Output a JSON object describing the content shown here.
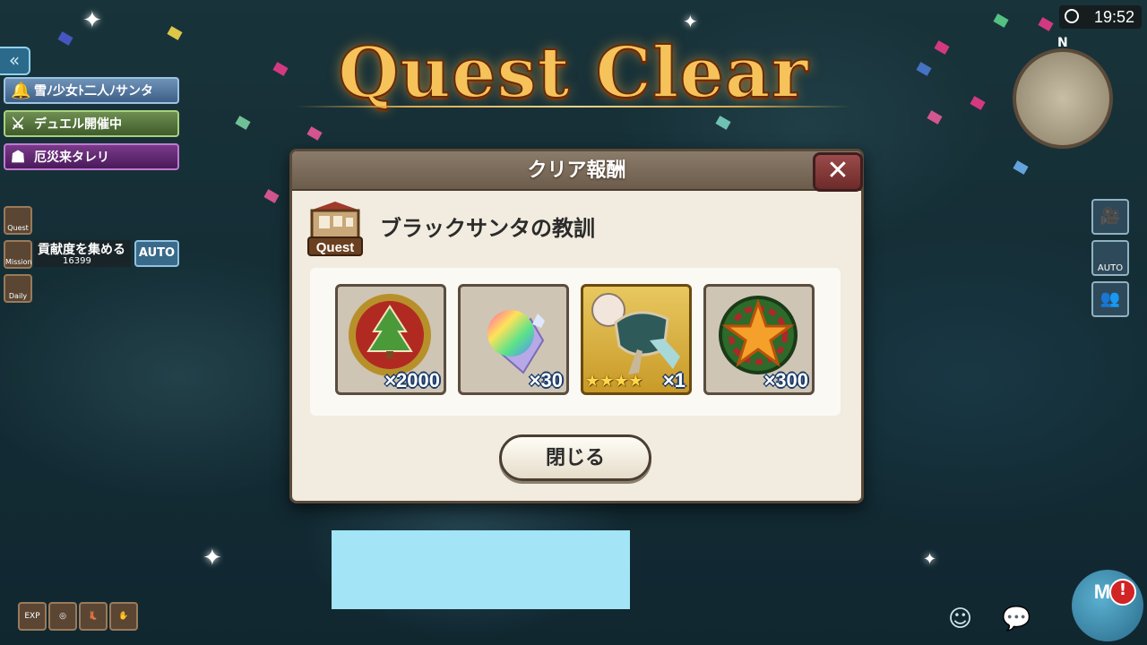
{
  "title": "Quest Clear",
  "time": "19:52",
  "compass_label": "N",
  "dialog": {
    "header": "クリア報酬",
    "close_symbol": "✕",
    "quest_icon_label": "Quest",
    "quest_name": "ブラックサンタの教訓",
    "rewards": [
      {
        "icon": "christmas-tree-medal-icon",
        "quantity": "×2000",
        "stars": ""
      },
      {
        "icon": "rainbow-crystal-icon",
        "quantity": "×30",
        "stars": ""
      },
      {
        "icon": "scarf-accessory-icon",
        "quantity": "×1",
        "stars": "★★★★"
      },
      {
        "icon": "star-wreath-icon",
        "quantity": "×300",
        "stars": ""
      }
    ],
    "close_button": "閉じる"
  },
  "side_menu": {
    "back_symbol": "«",
    "event_santa": "雪ﾉ少女ﾄ二人ﾉサンタ",
    "duel": "デュエル開催中",
    "calamity": "厄災来タレリ",
    "quest_label": "Quest",
    "mission_label": "Mission",
    "daily_label": "Daily",
    "mission_text": "貢献度を集める",
    "mission_count": "16399",
    "auto_label": "AUTO"
  },
  "right_controls": {
    "auto_label": "AUTO"
  },
  "bottom": {
    "exp_label": "EXP",
    "me_label": "Me",
    "alert_symbol": "!"
  },
  "colors": {
    "title_gold": "#f6c35a",
    "dialog_bg": "#f1ecdf",
    "header_brown": "#7b6c5c",
    "quantity_outline": "#1c3c6a",
    "cyan_block": "#a3e4f6"
  }
}
